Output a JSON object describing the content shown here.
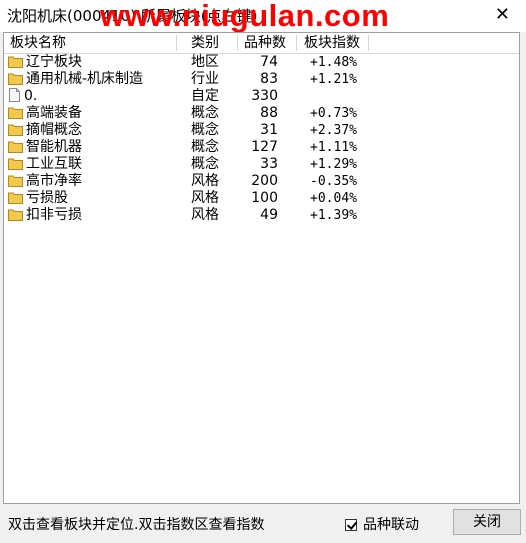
{
  "window": {
    "title": "沈阳机床(000410) 所属板块(点右键)",
    "watermark": "www.niugulan.com",
    "close_glyph": "✕"
  },
  "table": {
    "columns": [
      "板块名称",
      "类别",
      "品种数",
      "板块指数"
    ],
    "rows": [
      {
        "icon": "folder-icon",
        "name": "辽宁板块",
        "type": "地区",
        "count": "74",
        "change": "+1.48%"
      },
      {
        "icon": "folder-icon",
        "name": "通用机械-机床制造",
        "type": "行业",
        "count": "83",
        "change": "+1.21%"
      },
      {
        "icon": "document-icon",
        "name": "0.",
        "type": "自定",
        "count": "330",
        "change": ""
      },
      {
        "icon": "folder-icon",
        "name": "高端装备",
        "type": "概念",
        "count": "88",
        "change": "+0.73%"
      },
      {
        "icon": "folder-icon",
        "name": "摘帽概念",
        "type": "概念",
        "count": "31",
        "change": "+2.37%"
      },
      {
        "icon": "folder-icon",
        "name": "智能机器",
        "type": "概念",
        "count": "127",
        "change": "+1.11%"
      },
      {
        "icon": "folder-icon",
        "name": "工业互联",
        "type": "概念",
        "count": "33",
        "change": "+1.29%"
      },
      {
        "icon": "folder-icon",
        "name": "高市净率",
        "type": "风格",
        "count": "200",
        "change": "-0.35%"
      },
      {
        "icon": "folder-icon",
        "name": "亏损股",
        "type": "风格",
        "count": "100",
        "change": "+0.04%"
      },
      {
        "icon": "folder-icon",
        "name": "扣非亏损",
        "type": "风格",
        "count": "49",
        "change": "+1.39%"
      }
    ]
  },
  "footer": {
    "hint": "双击查看板块并定位.双击指数区查看指数",
    "checkbox_label": "品种联动",
    "checkbox_checked": true,
    "close_button": "关闭"
  },
  "colors": {
    "watermark": "#ff0000",
    "folder": "#f2c94c"
  }
}
